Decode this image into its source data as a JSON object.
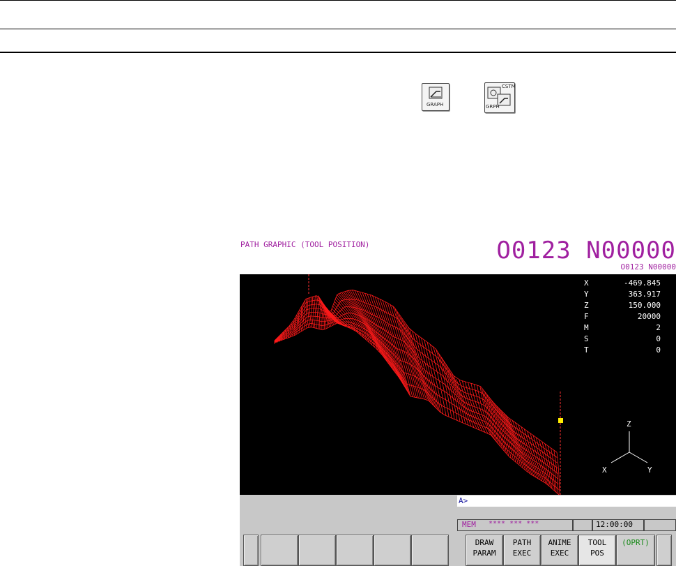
{
  "screen": {
    "title": "PATH GRAPHIC (TOOL POSITION)",
    "program_big": "O0123 N00000",
    "program_small": "O0123 N00000"
  },
  "readout": [
    {
      "axis": "X",
      "value": "-469.845"
    },
    {
      "axis": "Y",
      "value": "363.917"
    },
    {
      "axis": "Z",
      "value": "150.000"
    },
    {
      "axis": "F",
      "value": "20000"
    },
    {
      "axis": "M",
      "value": "2"
    },
    {
      "axis": "S",
      "value": "0"
    },
    {
      "axis": "T",
      "value": "0"
    }
  ],
  "axes_labels": {
    "z": "Z",
    "x": "X",
    "y": "Y"
  },
  "input": {
    "prompt": "A>"
  },
  "status": {
    "mode": "MEM",
    "stars": "**** *** ***",
    "time": "12:00:00"
  },
  "softkeys": [
    {
      "line1": "",
      "line2": ""
    },
    {
      "line1": "",
      "line2": ""
    },
    {
      "line1": "",
      "line2": ""
    },
    {
      "line1": "",
      "line2": ""
    },
    {
      "line1": "",
      "line2": ""
    },
    {
      "line1": "DRAW",
      "line2": "PARAM"
    },
    {
      "line1": "PATH",
      "line2": "EXEC"
    },
    {
      "line1": "ANIME",
      "line2": "EXEC"
    },
    {
      "line1": "TOOL",
      "line2": "POS"
    },
    {
      "line1": "(OPRT)",
      "line2": ""
    }
  ],
  "keys": {
    "graph_label": "GRAPH",
    "cstm_label": "CSTM",
    "grph_label": "GRPH"
  },
  "colors": {
    "path": "#ff1a1a",
    "magenta": "#a020a0",
    "tool_marker": "#ffee00"
  }
}
